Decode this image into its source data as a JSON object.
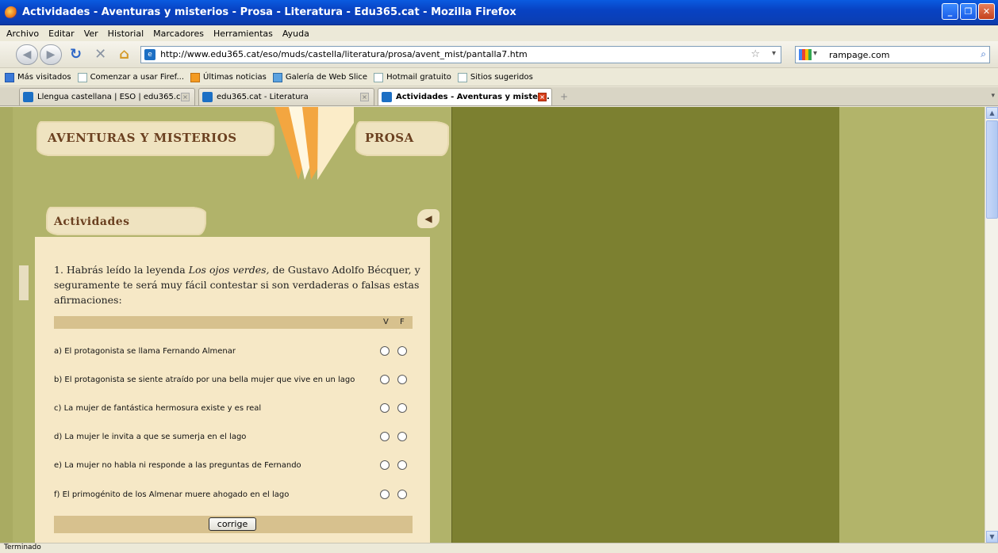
{
  "window": {
    "title": "Actividades - Aventuras y misterios - Prosa - Literatura - Edu365.cat - Mozilla Firefox",
    "buttons": [
      "minimize",
      "restore",
      "close"
    ]
  },
  "menu": [
    "Archivo",
    "Editar",
    "Ver",
    "Historial",
    "Marcadores",
    "Herramientas",
    "Ayuda"
  ],
  "navigation": {
    "url": "http://www.edu365.cat/eso/muds/castella/literatura/prosa/avent_mist/pantalla7.htm",
    "search_value": "rampage.com"
  },
  "bookmarks": [
    "Más visitados",
    "Comenzar a usar Firef...",
    "Últimas noticias",
    "Galería de Web Slice",
    "Hotmail gratuito",
    "Sitios sugeridos"
  ],
  "tabs": [
    {
      "label": "Llengua castellana | ESO | edu365.cat",
      "active": false
    },
    {
      "label": "edu365.cat - Literatura",
      "active": false
    },
    {
      "label": "Actividades - Aventuras y mister...",
      "active": true
    }
  ],
  "page": {
    "banner_left": "AVENTURAS Y MISTERIOS",
    "banner_right": "PROSA",
    "section_title": "Actividades",
    "question_prefix": "1. Habrás leído la leyenda ",
    "question_italic": "Los ojos verdes,",
    "question_suffix": " de Gustavo Adolfo Bécquer, y seguramente te será muy fácil contestar si son verdaderas o falsas estas afirmaciones:",
    "col_v": "V",
    "col_f": "F",
    "statements": [
      "a) El protagonista se llama Fernando Almenar",
      "b) El protagonista se siente atraído por una bella mujer que vive en un lago",
      "c) La mujer de fantástica hermosura existe y es real",
      "d) La mujer le invita a que se sumerja en el lago",
      "e) La mujer no habla ni responde a las preguntas de Fernando",
      "f) El primogénito de los Almenar muere ahogado en el lago"
    ],
    "button_label": "corrige"
  },
  "status": "Terminado",
  "colors": {
    "titlebar": "#0a5be0",
    "left_pane": "#b1b36a",
    "mid_pane": "#7c8030",
    "panel": "#f6e8c6",
    "heading": "#6b4020"
  }
}
